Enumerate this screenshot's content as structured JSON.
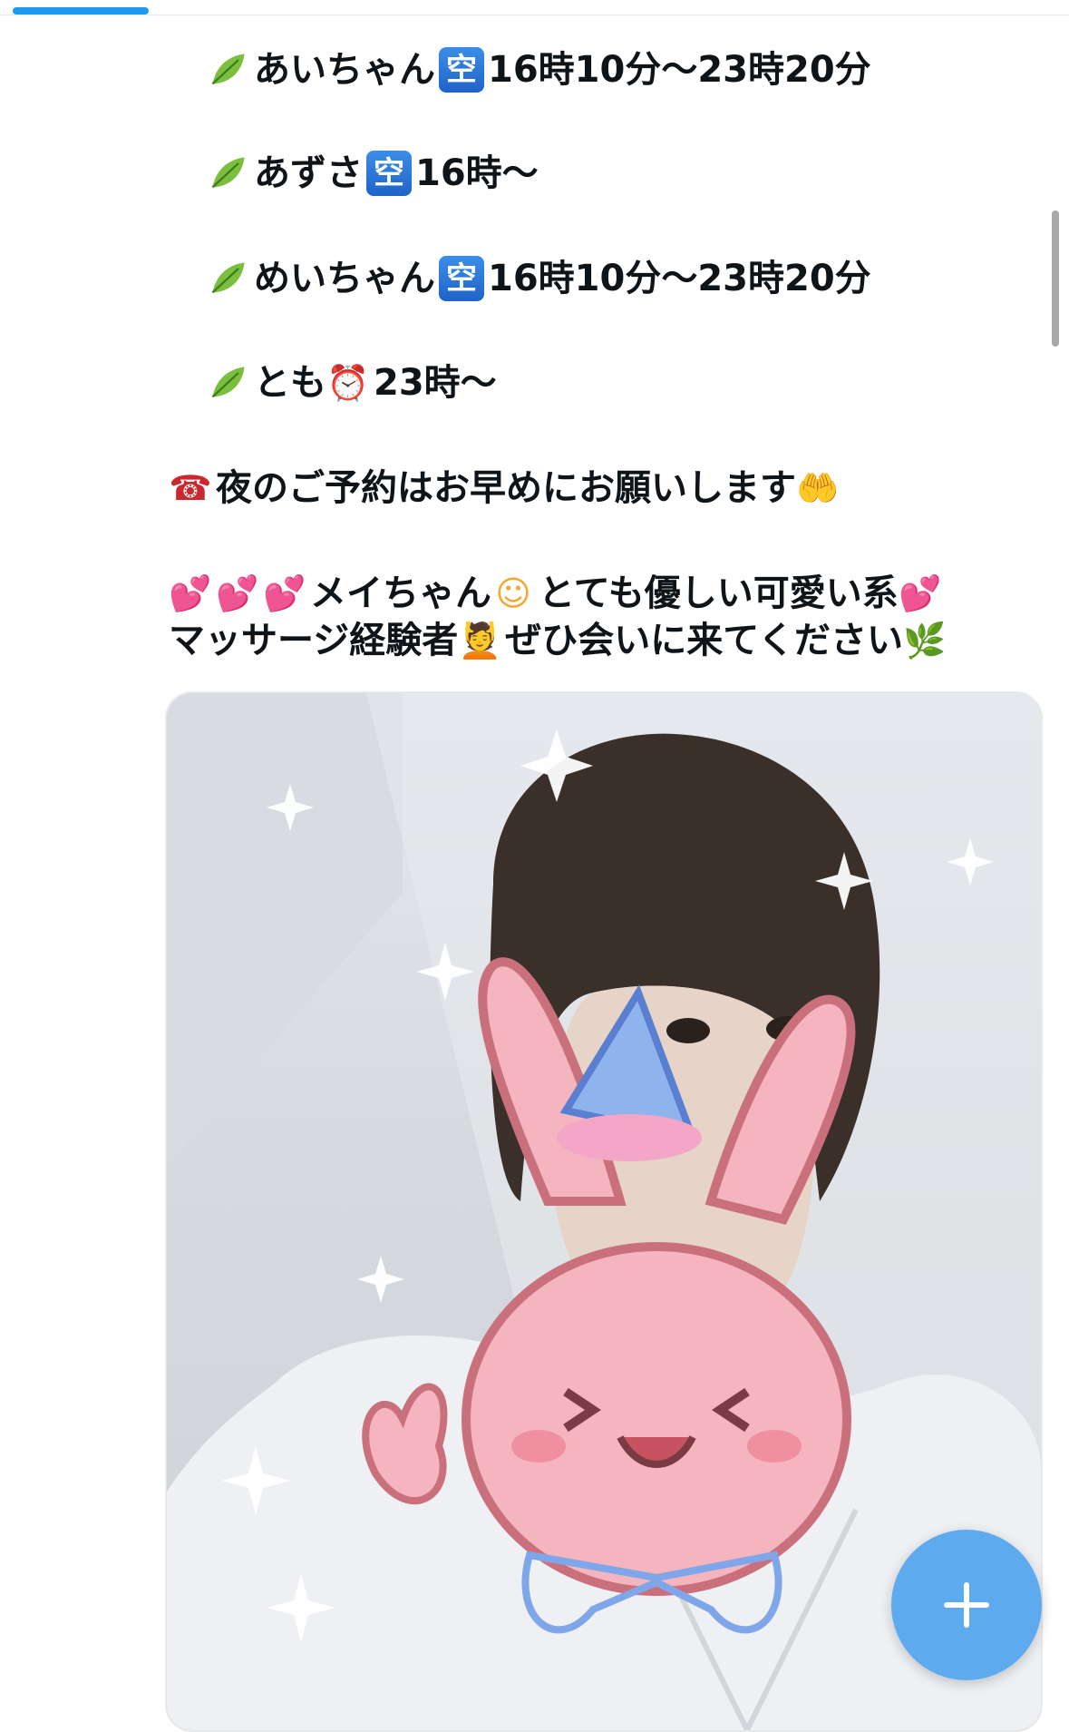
{
  "nav": {
    "active_tab_color": "#1d9bf0"
  },
  "schedule": [
    {
      "icon": "leaf-icon",
      "name": "あいちゃん",
      "status_icon": "vacant-icon",
      "status_glyph": "空",
      "time": "16時10分〜23時20分"
    },
    {
      "icon": "leaf-icon",
      "name": "あずさ",
      "status_icon": "vacant-icon",
      "status_glyph": "空",
      "time": "16時〜"
    },
    {
      "icon": "leaf-icon",
      "name": "めいちゃん",
      "status_icon": "vacant-icon",
      "status_glyph": "空",
      "time": "16時10分〜23時20分"
    },
    {
      "icon": "leaf-icon",
      "name": "とも",
      "status_icon": "alarm-clock-icon",
      "status_glyph": "⏰",
      "time": "23時〜"
    }
  ],
  "notice": {
    "icon": "telephone-icon",
    "icon_glyph": "☎",
    "text": "夜のご予約はお早めにお願いします",
    "end_icon": "raising-hands-icon",
    "end_glyph": "🤲"
  },
  "promo": {
    "lead_icons": [
      "💕",
      "💕",
      "💕"
    ],
    "line1_text_a": "メイちゃん",
    "line1_icon": "☺",
    "line1_text_b": "とても優しい可愛い系",
    "line1_end_icon": "💕",
    "line2_text_a": "マッサージ経験者",
    "line2_icon": "💆",
    "line2_text_b": "ぜひ会いに来てください",
    "line2_end_icon": "🌿"
  },
  "photo": {
    "alt": "",
    "description": ""
  },
  "fab": {
    "icon": "plus-icon",
    "color": "#4da2ee"
  }
}
